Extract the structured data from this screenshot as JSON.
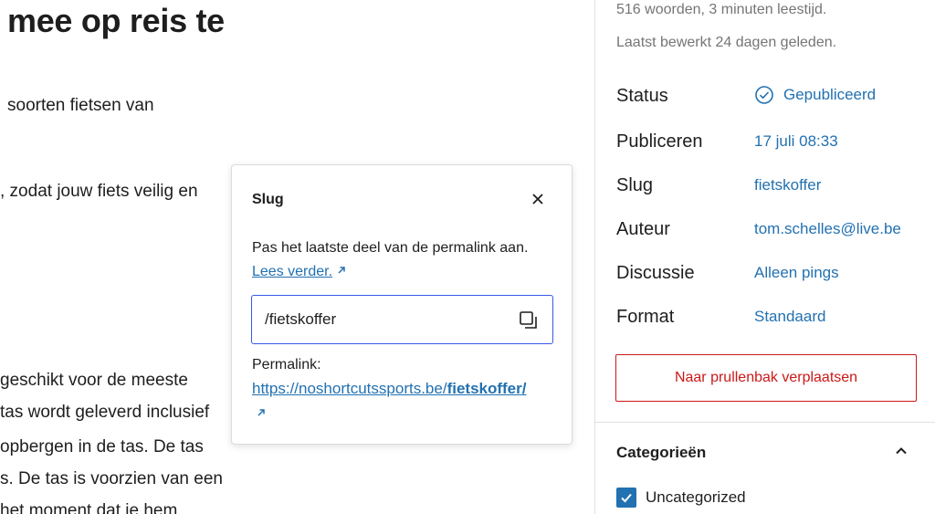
{
  "editor": {
    "title": "mee op reis te",
    "lines": [
      "soorten fietsen van",
      ", zodat jouw fiets veilig en",
      " geschikt voor de meeste",
      "tas wordt geleverd inclusief",
      "opbergen in de tas. De tas",
      "s. De tas is voorzien van een",
      " het moment dat je hem"
    ]
  },
  "popover": {
    "title": "Slug",
    "help_text": "Pas het laatste deel van de permalink aan.",
    "help_link": "Lees verder.",
    "slug_value": "/fietskoffer",
    "permalink_label": "Permalink:",
    "permalink_base": "https://noshortcutssports.be/",
    "permalink_slug": "fietskoffer",
    "permalink_trail": "/",
    "icons": {
      "close": "close-icon",
      "copy": "copy-icon",
      "external": "external-link-icon"
    }
  },
  "sidebar": {
    "word_count": "516 woorden, 3 minuten leestijd.",
    "last_edited": "Laatst bewerkt 24 dagen geleden.",
    "rows": [
      {
        "label": "Status",
        "value": "Gepubliceerd"
      },
      {
        "label": "Publiceren",
        "value": "17 juli 08:33"
      },
      {
        "label": "Slug",
        "value": "fietskoffer"
      },
      {
        "label": "Auteur",
        "value": "tom.schelles@live.be"
      },
      {
        "label": "Discussie",
        "value": "Alleen pings"
      },
      {
        "label": "Format",
        "value": "Standaard"
      }
    ],
    "trash_label": "Naar prullenbak verplaatsen",
    "categories_title": "Categorieën",
    "categories": [
      {
        "label": "Uncategorized",
        "checked": true
      }
    ]
  },
  "colors": {
    "accent": "#2271b1",
    "focus": "#3858e9",
    "danger": "#cc1818",
    "muted": "#757575"
  }
}
